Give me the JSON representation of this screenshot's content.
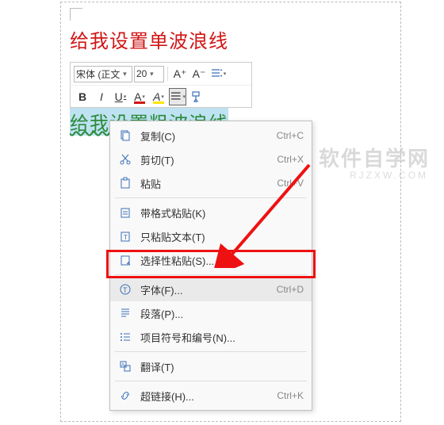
{
  "document": {
    "line1": "给我设置单波浪线",
    "line2": "给",
    "line3": "给我设置粗波浪线"
  },
  "toolbar": {
    "font_name": "宋体 (正文",
    "font_size": "20",
    "increase_font": "A⁺",
    "decrease_font": "A⁻",
    "bold": "B",
    "italic": "I",
    "underline": "U",
    "font_color": "A",
    "highlight": "A",
    "format_brush": "格"
  },
  "context_menu": {
    "items": [
      {
        "icon": "copy",
        "label": "复制(C)",
        "shortcut": "Ctrl+C"
      },
      {
        "icon": "cut",
        "label": "剪切(T)",
        "shortcut": "Ctrl+X"
      },
      {
        "icon": "paste",
        "label": "粘贴",
        "shortcut": "Ctrl+V"
      },
      {
        "icon": "paste-format",
        "label": "带格式粘贴(K)",
        "shortcut": ""
      },
      {
        "icon": "paste-text",
        "label": "只粘贴文本(T)",
        "shortcut": ""
      },
      {
        "icon": "paste-special",
        "label": "选择性粘贴(S)...",
        "shortcut": ""
      },
      {
        "icon": "font",
        "label": "字体(F)...",
        "shortcut": "Ctrl+D"
      },
      {
        "icon": "paragraph",
        "label": "段落(P)...",
        "shortcut": ""
      },
      {
        "icon": "bullets",
        "label": "项目符号和编号(N)...",
        "shortcut": ""
      },
      {
        "icon": "translate",
        "label": "翻译(T)",
        "shortcut": ""
      },
      {
        "icon": "link",
        "label": "超链接(H)...",
        "shortcut": "Ctrl+K"
      }
    ]
  },
  "watermark": {
    "main": "软件自学网",
    "sub": "RJZXW.COM"
  },
  "highlight_item_index": 6
}
